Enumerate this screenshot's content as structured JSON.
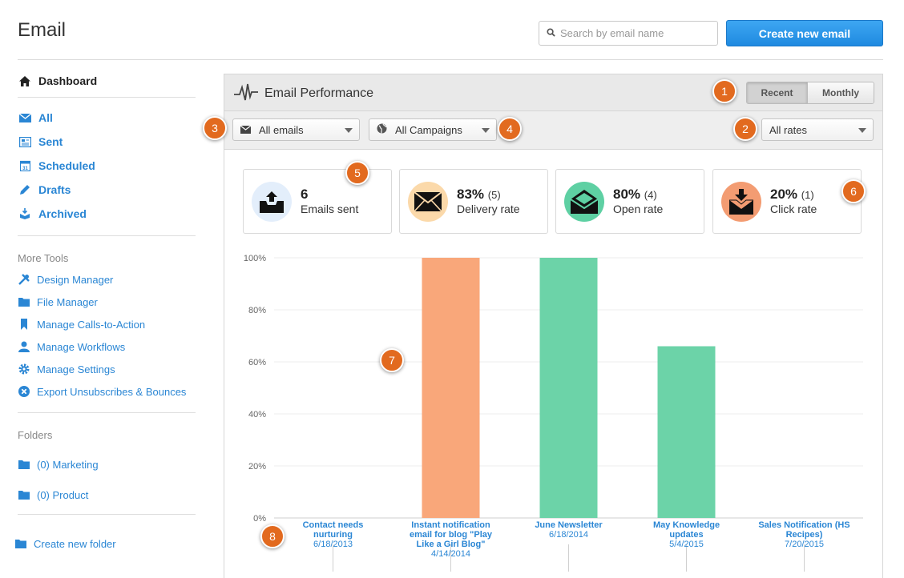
{
  "header": {
    "title": "Email",
    "search_placeholder": "Search by email name",
    "create_button": "Create new email"
  },
  "sidebar": {
    "dashboard": "Dashboard",
    "nav": [
      {
        "label": "All",
        "icon": "envelope-icon"
      },
      {
        "label": "Sent",
        "icon": "newspaper-icon"
      },
      {
        "label": "Scheduled",
        "icon": "calendar-icon"
      },
      {
        "label": "Drafts",
        "icon": "pencil-icon"
      },
      {
        "label": "Archived",
        "icon": "archive-icon"
      }
    ],
    "tools_title": "More Tools",
    "tools": [
      {
        "label": "Design Manager",
        "icon": "tools-icon"
      },
      {
        "label": "File Manager",
        "icon": "folder-icon"
      },
      {
        "label": "Manage Calls-to-Action",
        "icon": "bookmark-icon"
      },
      {
        "label": "Manage Workflows",
        "icon": "user-icon"
      },
      {
        "label": "Manage Settings",
        "icon": "gear-icon"
      },
      {
        "label": "Export Unsubscribes & Bounces",
        "icon": "x-circle-icon"
      }
    ],
    "folders_title": "Folders",
    "folders": [
      {
        "label": "(0) Marketing"
      },
      {
        "label": "(0) Product"
      }
    ],
    "create_folder": "Create new folder"
  },
  "panel": {
    "title": "Email Performance",
    "toggle": {
      "recent": "Recent",
      "monthly": "Monthly"
    },
    "filters": {
      "emails": "All emails",
      "campaigns": "All Campaigns",
      "rates": "All rates"
    },
    "cards": [
      {
        "value": "6",
        "count": "",
        "label": "Emails sent",
        "color": "#e3eefb"
      },
      {
        "value": "83%",
        "count": "(5)",
        "label": "Delivery rate",
        "color": "#fbd9aa"
      },
      {
        "value": "80%",
        "count": "(4)",
        "label": "Open rate",
        "color": "#5ed0a3"
      },
      {
        "value": "20%",
        "count": "(1)",
        "label": "Click rate",
        "color": "#f39c72"
      }
    ]
  },
  "badges": [
    "1",
    "2",
    "3",
    "4",
    "5",
    "6",
    "7",
    "8"
  ],
  "chart_data": {
    "type": "bar",
    "categories": [
      "Contact needs nurturing",
      "Instant notification email for blog \"Play Like a Girl Blog\"",
      "June Newsletter",
      "May Knowledge updates",
      "Sales Notification (HS Recipes)"
    ],
    "category_lines": [
      [
        "Contact needs",
        "nurturing"
      ],
      [
        "Instant notification",
        "email for blog \"Play",
        "Like a Girl Blog\""
      ],
      [
        "June Newsletter"
      ],
      [
        "May Knowledge",
        "updates"
      ],
      [
        "Sales Notification (HS",
        "Recipes)"
      ]
    ],
    "dates": [
      "6/18/2013",
      "4/14/2014",
      "6/18/2014",
      "5/4/2015",
      "7/20/2015"
    ],
    "values": [
      0,
      100,
      100,
      66,
      0
    ],
    "bar_colors": [
      "#f9a77a",
      "#f9a77a",
      "#6cd3a8",
      "#6cd3a8",
      "#6cd3a8"
    ],
    "yticks": [
      "0%",
      "20%",
      "40%",
      "60%",
      "80%",
      "100%"
    ],
    "ylim": [
      0,
      100
    ]
  }
}
